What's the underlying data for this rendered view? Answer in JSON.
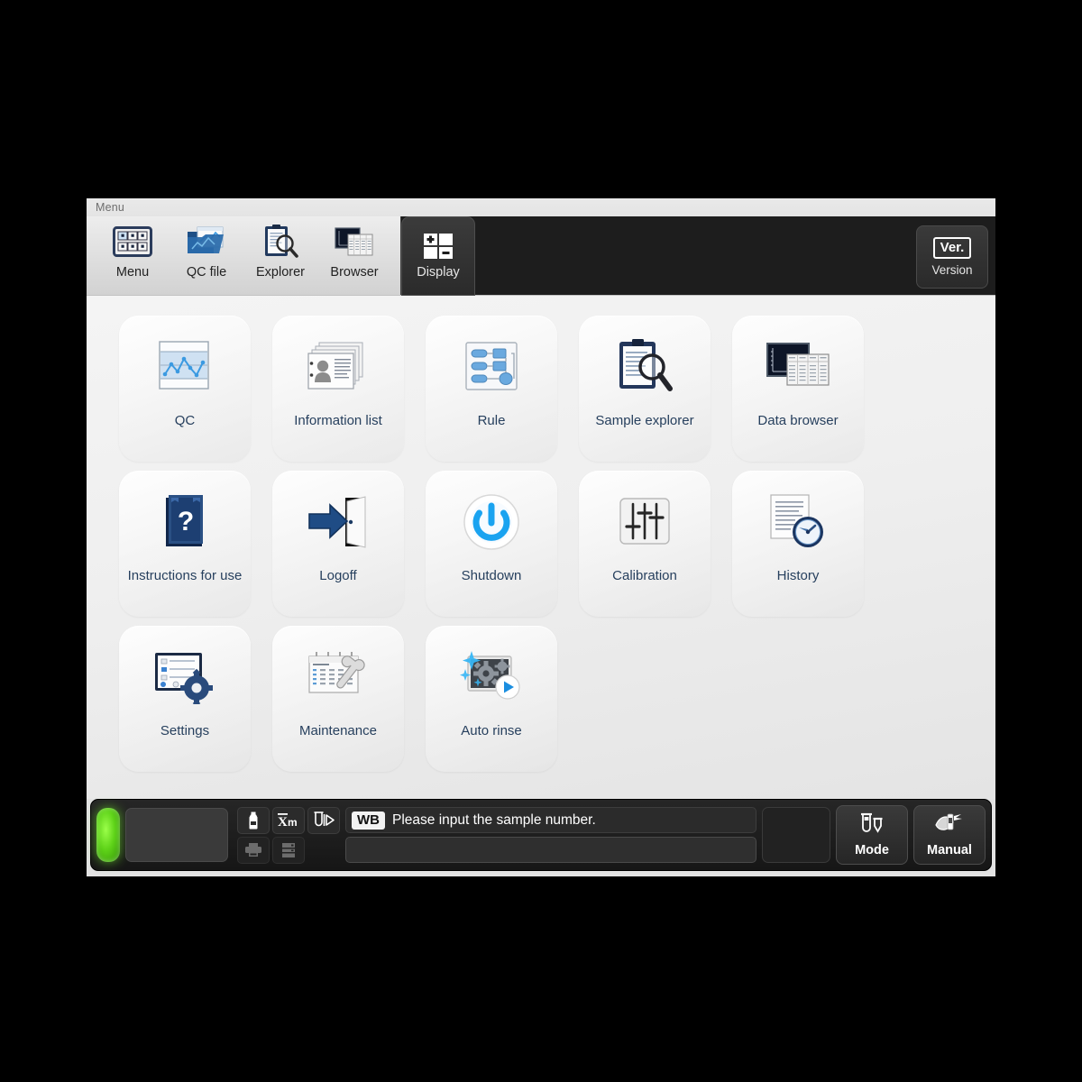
{
  "window": {
    "title": "Menu"
  },
  "toolbar": {
    "buttons": [
      {
        "label": "Menu",
        "icon": "menu-grid-icon"
      },
      {
        "label": "QC file",
        "icon": "qc-folder-chart-icon"
      },
      {
        "label": "Explorer",
        "icon": "clipboard-magnifier-icon"
      },
      {
        "label": "Browser",
        "icon": "chart-table-icon"
      }
    ],
    "display_tab": {
      "label": "Display",
      "icon": "grid-plus-minus-icon"
    },
    "version_button": {
      "badge": "Ver.",
      "label": "Version"
    }
  },
  "menu_grid": {
    "rows": [
      [
        {
          "label": "QC",
          "icon": "qc-chart-icon"
        },
        {
          "label": "Information list",
          "icon": "info-cards-icon"
        },
        {
          "label": "Rule",
          "icon": "rule-flow-icon"
        },
        {
          "label": "Sample explorer",
          "icon": "clipboard-magnifier-icon"
        },
        {
          "label": "Data browser",
          "icon": "chart-table-icon"
        }
      ],
      [
        {
          "label": "Instructions for use",
          "icon": "blue-book-question-icon"
        },
        {
          "label": "Logoff",
          "icon": "arrow-door-icon"
        },
        {
          "label": "Shutdown",
          "icon": "power-icon"
        },
        {
          "label": "Calibration",
          "icon": "sliders-icon"
        },
        {
          "label": "History",
          "icon": "document-clock-icon"
        }
      ],
      [
        {
          "label": "Settings",
          "icon": "monitor-gear-icon"
        },
        {
          "label": "Maintenance",
          "icon": "calendar-wrench-icon"
        },
        {
          "label": "Auto rinse",
          "icon": "sparkle-gear-play-icon"
        }
      ]
    ]
  },
  "statusbar": {
    "led_status": "green",
    "icons": [
      {
        "name": "reagent-bottle-icon",
        "glyph": "bottle",
        "enabled": true
      },
      {
        "name": "mean-xm-icon",
        "glyph": "Xm",
        "enabled": true
      },
      {
        "name": "tube-run-icon",
        "glyph": "tuberun",
        "enabled": true
      },
      {
        "name": "printer-icon",
        "glyph": "printer",
        "enabled": false
      },
      {
        "name": "list-server-icon",
        "glyph": "list",
        "enabled": false
      }
    ],
    "mode_badge": "WB",
    "message": "Please input the sample number.",
    "sample_input_value": "",
    "sample_input_placeholder": "",
    "buttons": [
      {
        "label": "Mode",
        "icon": "test-tubes-icon"
      },
      {
        "label": "Manual",
        "icon": "manual-aspirate-icon"
      }
    ]
  },
  "colors": {
    "accent_blue": "#2f7fd0",
    "label_text": "#27405e",
    "led_green": "#5ed218",
    "dark_panel": "#1d1d1d"
  }
}
